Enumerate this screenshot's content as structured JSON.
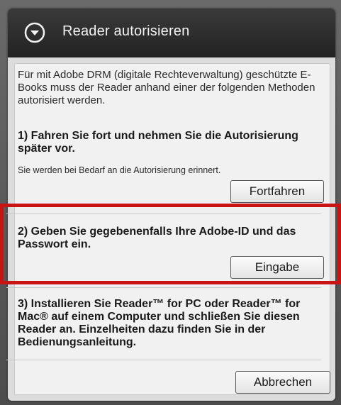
{
  "dialog": {
    "title": "Reader autorisieren",
    "intro": "Für mit Adobe DRM (digitale Rechteverwaltung) geschützte E-Books muss der Reader anhand einer der folgenden Methoden autorisiert werden.",
    "option1": {
      "heading": "1) Fahren Sie fort und nehmen Sie die Autorisierung später vor.",
      "note": "Sie werden bei Bedarf an die Autorisierung erinnert.",
      "button": "Fortfahren"
    },
    "option2": {
      "heading": "2) Geben Sie gegebenenfalls Ihre Adobe-ID und das Passwort ein.",
      "button": "Eingabe"
    },
    "option3": {
      "heading": "3) Installieren Sie Reader™ for PC oder Reader™ for Mac® auf einem Computer und schließen Sie diesen Reader an. Einzelheiten dazu finden Sie in der Bedienungsanleitung."
    },
    "cancel_button": "Abbrechen"
  },
  "icons": {
    "title_icon": "chevron-down-circle-icon"
  },
  "colors": {
    "highlight": "#c91414",
    "titlebar": "#2e2e2e",
    "panel": "#f1f1f1"
  }
}
